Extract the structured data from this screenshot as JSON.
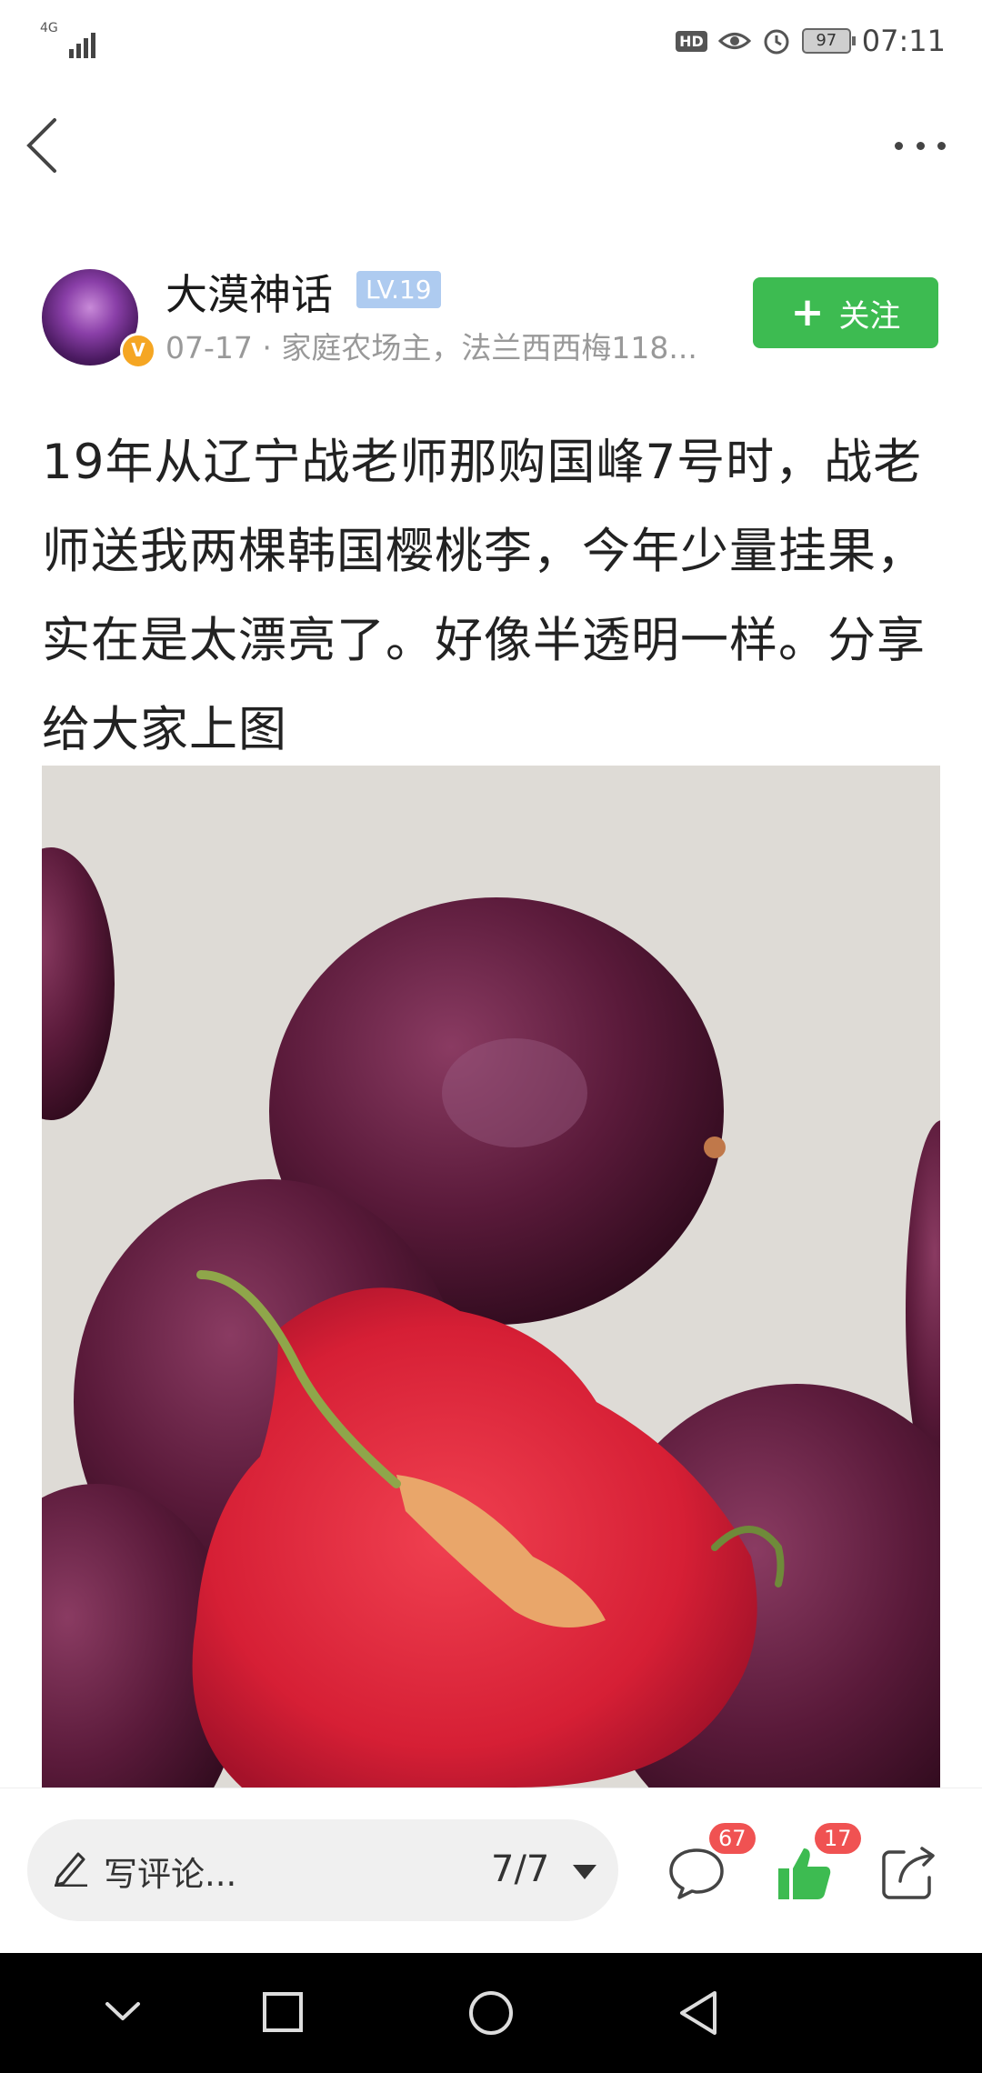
{
  "status_bar": {
    "network": "4G",
    "hd": "HD",
    "battery": "97",
    "time": "07:11"
  },
  "author": {
    "name": "大漠神话",
    "level": "LV.19",
    "badge": "V",
    "meta": "07-17 · 家庭农场主，法兰西西梅118..."
  },
  "follow_label": "关注",
  "post": {
    "text": "19年从辽宁战老师那购国峰7号时，战老师送我两棵韩国樱桃李，今年少量挂果，实在是太漂亮了。好像半透明一样。分享给大家上图"
  },
  "bottom_bar": {
    "comment_placeholder": "写评论...",
    "page_indicator": "7/7",
    "comment_count": "67",
    "like_count": "17",
    "like_color": "#3dbb51"
  }
}
